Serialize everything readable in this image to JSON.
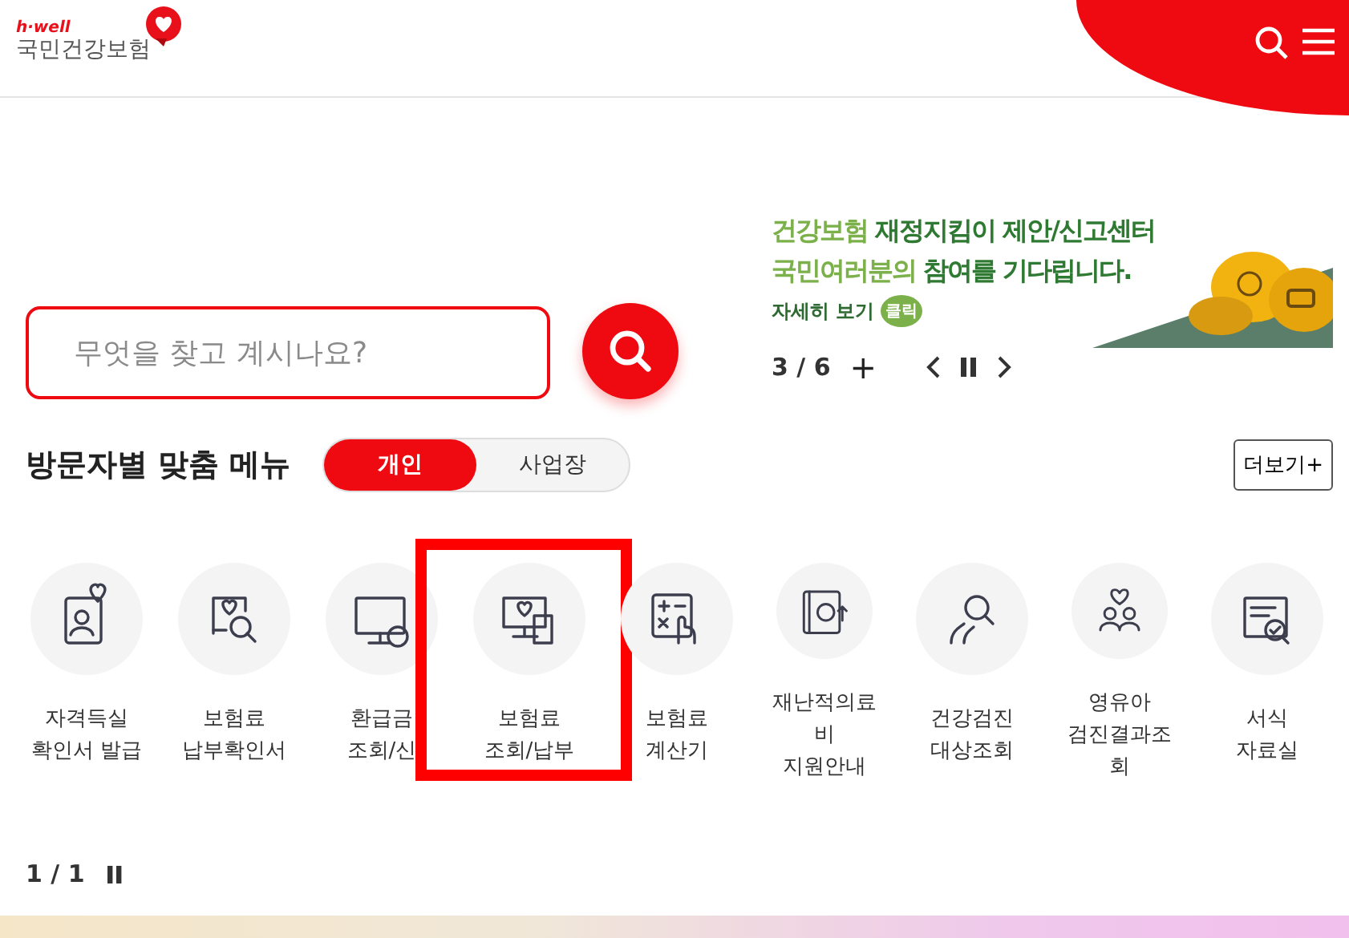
{
  "header": {
    "logo_tagline": "h·well",
    "logo_name": "국민건강보험"
  },
  "search": {
    "placeholder": "무엇을 찾고 계시나요?"
  },
  "banner": {
    "lines": [
      [
        {
          "text": "건강보험 ",
          "emphasis": false
        },
        {
          "text": "재정지킴이 제안/신고센터",
          "emphasis": true
        }
      ],
      [
        {
          "text": "국민여러분",
          "emphasis": false
        },
        {
          "text": "의 ",
          "emphasis": false
        },
        {
          "text": "참여를 기다립니다.",
          "emphasis": true
        }
      ]
    ],
    "link": "자세히 보기",
    "badge": "클릭",
    "pager": "3 / 6",
    "plus": "+"
  },
  "menu": {
    "title": "방문자별 맞춤 메뉴",
    "tabs": [
      {
        "label": "개인",
        "selected": true
      },
      {
        "label": "사업장",
        "selected": false
      }
    ],
    "more": "더보기+",
    "items": [
      {
        "lines": [
          "자격득실",
          "확인서 발급"
        ],
        "highlighted": false
      },
      {
        "lines": [
          "보험료",
          "납부확인서"
        ],
        "highlighted": false
      },
      {
        "lines": [
          "환급금",
          "조회/신"
        ],
        "highlighted": false
      },
      {
        "lines": [
          "보험료",
          "조회/납부"
        ],
        "highlighted": true
      },
      {
        "lines": [
          "보험료",
          "계산기"
        ],
        "highlighted": false
      },
      {
        "lines": [
          "재난적의료",
          "비",
          "지원안내"
        ],
        "highlighted": false
      },
      {
        "lines": [
          "건강검진",
          "대상조회"
        ],
        "highlighted": false
      },
      {
        "lines": [
          "영유아",
          "검진결과조",
          "회"
        ],
        "highlighted": false
      },
      {
        "lines": [
          "서식",
          "자료실"
        ],
        "highlighted": false
      }
    ],
    "pager": "1 / 1"
  }
}
